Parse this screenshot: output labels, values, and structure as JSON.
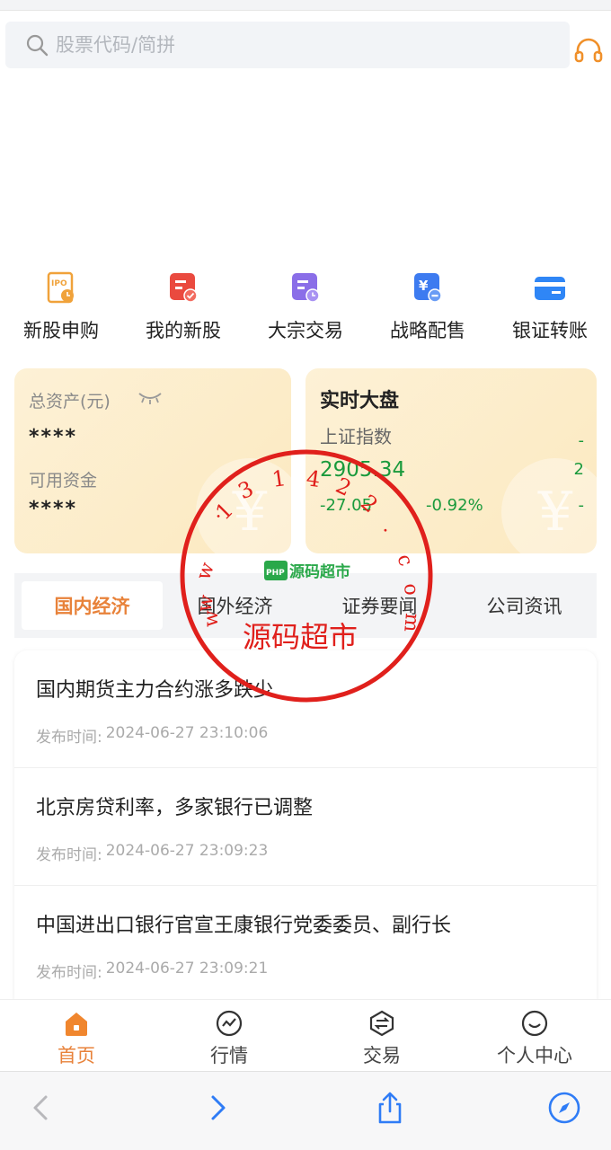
{
  "search": {
    "placeholder": "股票代码/简拼"
  },
  "quick_menu": [
    {
      "label": "新股申购",
      "icon": "ipo-icon",
      "color": "#f0a23a"
    },
    {
      "label": "我的新股",
      "icon": "my-stock-icon",
      "color": "#ea4a3f"
    },
    {
      "label": "大宗交易",
      "icon": "block-trade-icon",
      "color": "#8a6ee8"
    },
    {
      "label": "战略配售",
      "icon": "strategic-placement-icon",
      "color": "#3d7bf0"
    },
    {
      "label": "银证转账",
      "icon": "bank-transfer-icon",
      "color": "#2f86f6"
    }
  ],
  "assets_card": {
    "total_label": "总资产(元)",
    "total_value": "****",
    "available_label": "可用资金",
    "available_value": "****"
  },
  "market_card": {
    "title": "实时大盘",
    "index_name": "上证指数",
    "index_value": "2905.34",
    "change": "-27.05",
    "change_pct": "-0.92%",
    "edge_1": "-",
    "edge_2": "2",
    "edge_3": "-"
  },
  "news_tabs": [
    "国内经济",
    "国外经济",
    "证券要闻",
    "公司资讯"
  ],
  "news_time_label": "发布时间:",
  "news": [
    {
      "title": "国内期货主力合约涨多跌少",
      "time": "2024-06-27 23:10:06"
    },
    {
      "title": "北京房贷利率，多家银行已调整",
      "time": "2024-06-27 23:09:23"
    },
    {
      "title": "中国进出口银行官宣王康银行党委委员、副行长",
      "time": "2024-06-27 23:09:21"
    }
  ],
  "tabbar": [
    {
      "label": "首页",
      "icon": "home-icon"
    },
    {
      "label": "行情",
      "icon": "market-icon"
    },
    {
      "label": "交易",
      "icon": "trade-icon"
    },
    {
      "label": "个人中心",
      "icon": "profile-icon"
    }
  ],
  "watermark": {
    "text": "源码超市",
    "url": "www.131422.com",
    "logo_text": "源码超市",
    "logo_badge": "PHP"
  },
  "colors": {
    "accent": "#e8823a",
    "down": "#1a9a3c",
    "stamp": "#e0201c"
  }
}
